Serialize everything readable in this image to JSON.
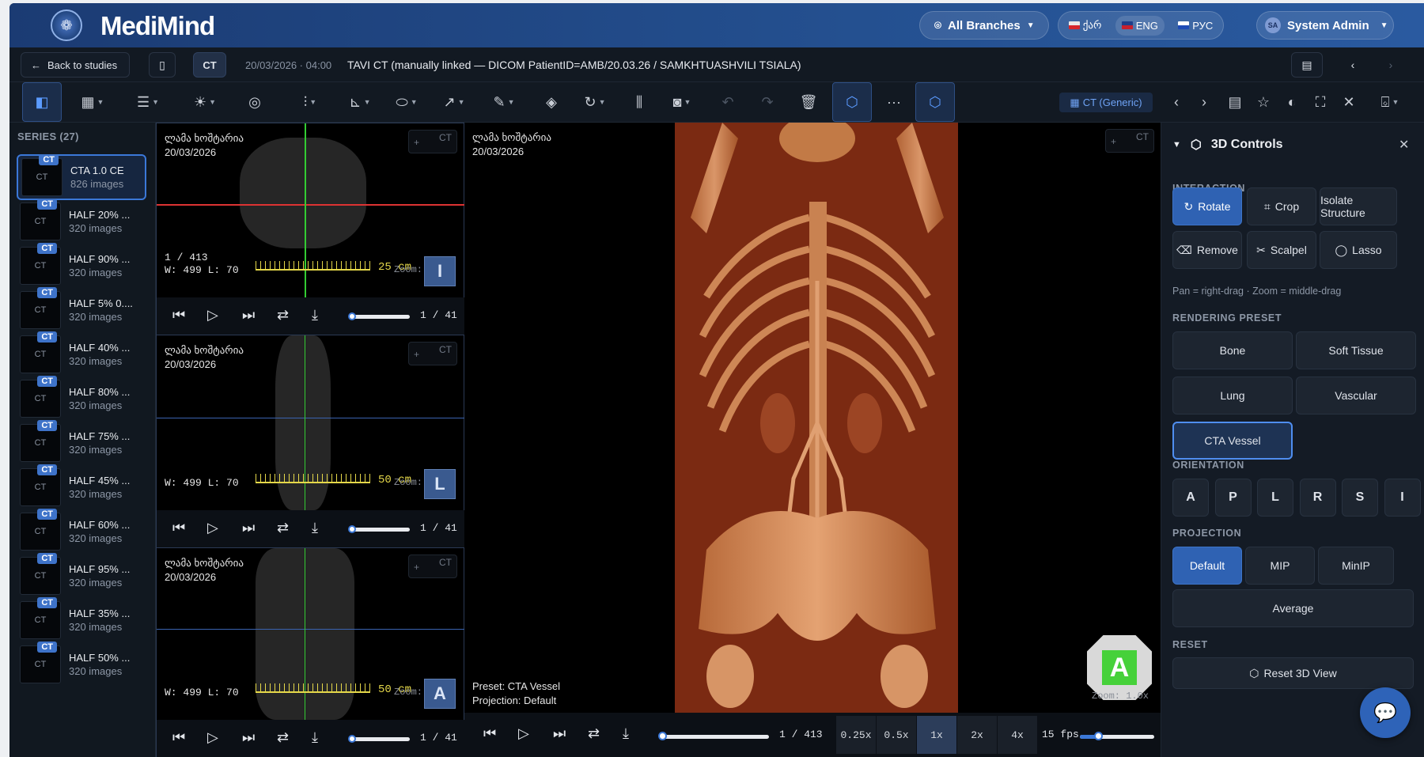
{
  "app": {
    "brand": "MediMind"
  },
  "header": {
    "branch_label": "All Branches",
    "languages": [
      {
        "label": "ქარ",
        "active": false
      },
      {
        "label": "ENG",
        "active": true
      },
      {
        "label": "РУС",
        "active": false
      }
    ],
    "user_initials": "SA",
    "user_name": "System Admin"
  },
  "studybar": {
    "back_label": "Back to studies",
    "modality": "CT",
    "date": "20/03/2026 · 04:00",
    "title": "TAVI CT (manually linked — DICOM PatientID=AMB/20.03.26 / SAMKHTUASHVILI TSIALA)"
  },
  "toolbar": {
    "preset_label": "CT (Generic)"
  },
  "series": {
    "header": "SERIES (27)",
    "items": [
      {
        "name": "CTA 1.0 CE",
        "count": "826 images",
        "thumb": "CT",
        "badge": "CT"
      },
      {
        "name": "HALF 20% ...",
        "count": "320 images",
        "thumb": "CT",
        "badge": "CT"
      },
      {
        "name": "HALF 90% ...",
        "count": "320 images",
        "thumb": "CT",
        "badge": "CT"
      },
      {
        "name": "HALF 5% 0....",
        "count": "320 images",
        "thumb": "CT",
        "badge": "CT"
      },
      {
        "name": "HALF 40% ...",
        "count": "320 images",
        "thumb": "CT",
        "badge": "CT"
      },
      {
        "name": "HALF 80% ...",
        "count": "320 images",
        "thumb": "CT",
        "badge": "CT"
      },
      {
        "name": "HALF 75% ...",
        "count": "320 images",
        "thumb": "CT",
        "badge": "CT"
      },
      {
        "name": "HALF 45% ...",
        "count": "320 images",
        "thumb": "CT",
        "badge": "CT"
      },
      {
        "name": "HALF 60% ...",
        "count": "320 images",
        "thumb": "CT",
        "badge": "CT"
      },
      {
        "name": "HALF 95% ...",
        "count": "320 images",
        "thumb": "CT",
        "badge": "CT"
      },
      {
        "name": "HALF 35% ...",
        "count": "320 images",
        "thumb": "CT",
        "badge": "CT"
      },
      {
        "name": "HALF 50% ...",
        "count": "320 images",
        "thumb": "CT",
        "badge": "CT"
      }
    ]
  },
  "viewports": [
    {
      "patient": "ლამა ხოშტარია",
      "date": "20/03/2026",
      "modality": "CT",
      "plus": "+",
      "frame": "1 / 413",
      "wl": "W: 499 L: 70",
      "scale": "25 cm",
      "zoom": "Zoom: 1.0x",
      "orient": "I",
      "counter": "1 / 41"
    },
    {
      "patient": "ლამა ხოშტარია",
      "date": "20/03/2026",
      "modality": "CT",
      "plus": "+",
      "frame": "",
      "wl": "W: 499 L: 70",
      "scale": "50 cm",
      "zoom": "Zoom: 1.0x",
      "orient": "L",
      "counter": "1 / 41"
    },
    {
      "patient": "ლამა ხოშტარია",
      "date": "20/03/2026",
      "modality": "CT",
      "plus": "+",
      "frame": "",
      "wl": "W: 499 L: 70",
      "scale": "50 cm",
      "zoom": "Zoom: 1.0x",
      "orient": "A",
      "counter": "1 / 41"
    }
  ],
  "main_viewport": {
    "patient": "ლამა ხოშტარია",
    "date": "20/03/2026",
    "modality": "CT",
    "plus": "+",
    "preset_line": "Preset: CTA Vessel",
    "projection_line": "Projection: Default",
    "zoom": "Zoom: 1.0x",
    "cube_label": "A",
    "counter": "1 / 413",
    "speeds": [
      {
        "label": "0.25x",
        "selected": false
      },
      {
        "label": "0.5x",
        "selected": false
      },
      {
        "label": "1x",
        "selected": true
      },
      {
        "label": "2x",
        "selected": false
      },
      {
        "label": "4x",
        "selected": false
      }
    ],
    "fps": "15 fps"
  },
  "controls3d": {
    "title": "3D Controls",
    "interaction_header": "INTERACTION",
    "interaction": [
      {
        "label": "Rotate",
        "icon": "rotate-icon"
      },
      {
        "label": "Crop",
        "icon": "crop-icon"
      },
      {
        "label": "Isolate Structure",
        "icon": ""
      },
      {
        "label": "Remove",
        "icon": "eraser-icon"
      },
      {
        "label": "Scalpel",
        "icon": "scissors-icon"
      },
      {
        "label": "Lasso",
        "icon": "lasso-icon"
      }
    ],
    "hint": "Pan = right-drag · Zoom = middle-drag",
    "rendering_header": "RENDERING PRESET",
    "presets": [
      "Bone",
      "Soft Tissue",
      "Lung",
      "Vascular",
      "CTA Vessel"
    ],
    "orientation_header": "ORIENTATION",
    "orientations": [
      "A",
      "P",
      "L",
      "R",
      "S",
      "I"
    ],
    "projection_header": "PROJECTION",
    "projections": [
      "Default",
      "MIP",
      "MinIP",
      "Average"
    ],
    "reset_header": "RESET",
    "reset_label": "Reset 3D View"
  }
}
